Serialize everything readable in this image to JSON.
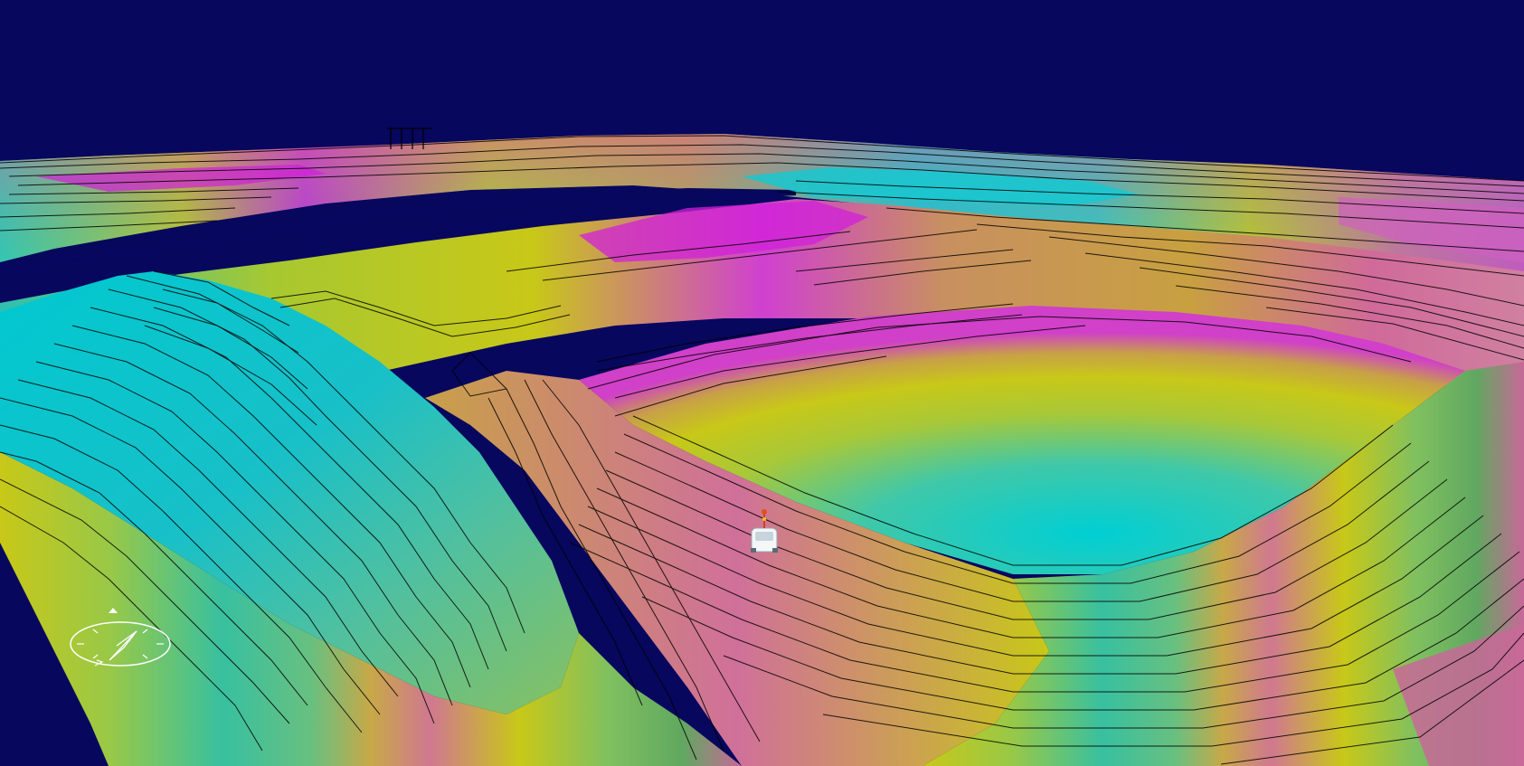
{
  "scene": {
    "sky_color": "#07075e",
    "terrain_colors": [
      "#00d0d8",
      "#30c8c0",
      "#7cc86a",
      "#c8c818",
      "#c9a83c",
      "#d28a6a",
      "#d06a9a",
      "#d020d8"
    ],
    "contour_color": "#000000",
    "vehicle_icon": "haul-truck-icon",
    "compass_icon": "compass-icon"
  }
}
